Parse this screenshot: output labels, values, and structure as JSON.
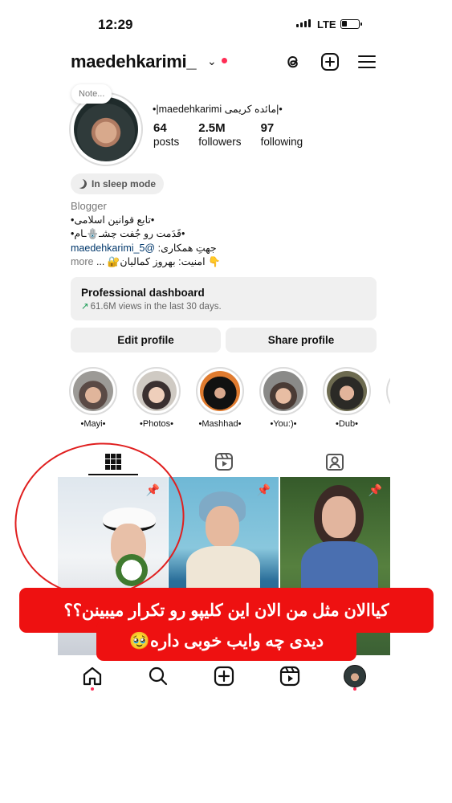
{
  "status_bar": {
    "time": "12:29",
    "network": "LTE"
  },
  "header": {
    "username": "maedehkarimi_"
  },
  "profile": {
    "note": "Note...",
    "full_name": "•|maedehkarimi  مائده کریمی|•",
    "stats": [
      {
        "value": "64",
        "label": "posts"
      },
      {
        "value": "2.5M",
        "label": "followers"
      },
      {
        "value": "97",
        "label": "following"
      }
    ],
    "sleep_mode": "In sleep mode",
    "bio": {
      "category": "Blogger",
      "line1": "•تابع قوانین اسلامی•",
      "line2": "•قَدَمت رو جُفت چشـ🪬ـام•",
      "line3_prefix": "جهتِ همکاری: ",
      "line3_link": "@maedehkarimi_5",
      "line4_more": "more",
      "line4_rest": " ... 🔐امنیت: بهروز کمالیان 👇"
    }
  },
  "dashboard": {
    "title": "Professional dashboard",
    "subtitle": "61.6M views in the last 30 days."
  },
  "buttons": {
    "edit": "Edit profile",
    "share": "Share profile"
  },
  "highlights": [
    {
      "label": "•Mayi•"
    },
    {
      "label": "•Photos•"
    },
    {
      "label": "•Mashhad•"
    },
    {
      "label": "•You:)•"
    },
    {
      "label": "•Dub•"
    }
  ],
  "icons": {
    "threads": "threads-icon",
    "create": "plus-square-icon",
    "menu": "hamburger-menu-icon",
    "grid": "grid-icon",
    "reels": "reels-icon",
    "tagged": "tagged-icon",
    "home": "home-icon",
    "search": "search-icon",
    "pin": "pin-icon"
  },
  "overlay": {
    "caption_line1": "کیاالان مثل من الان این کلیپو رو تکرار میبینن؟؟",
    "caption_line2": "دیدی چه وایب خوبی داره🥹"
  },
  "colors": {
    "accent_red": "#ee1111",
    "notification_dot": "#ff2d55",
    "link": "#00376b"
  }
}
